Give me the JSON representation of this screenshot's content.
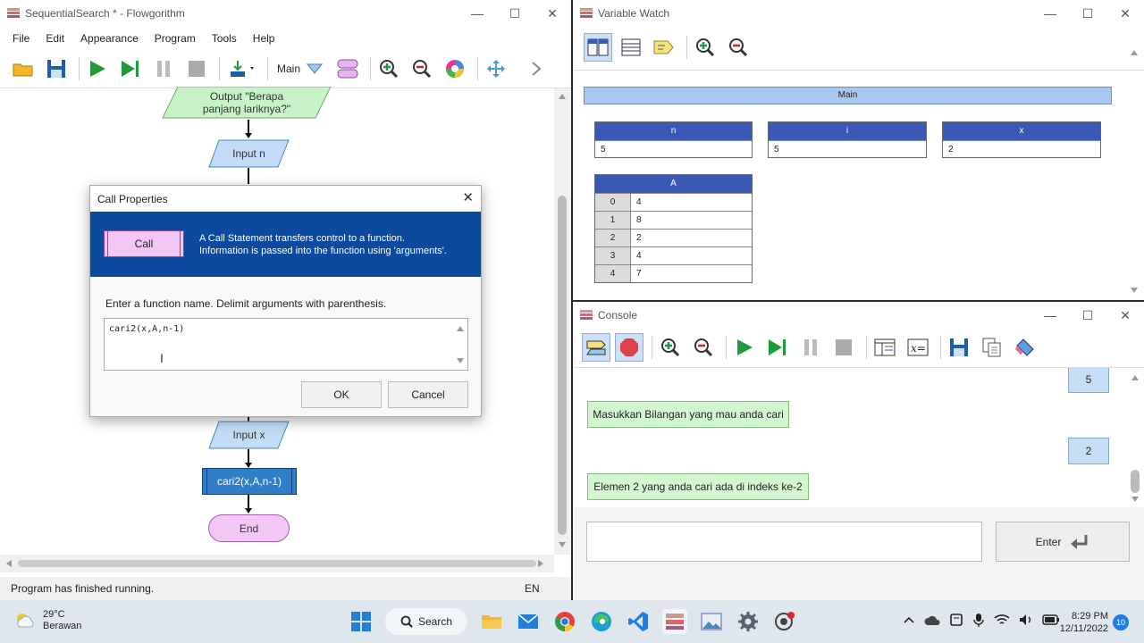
{
  "flowgorithm": {
    "title": "SequentialSearch * - Flowgorithm",
    "menu": [
      "File",
      "Edit",
      "Appearance",
      "Program",
      "Tools",
      "Help"
    ],
    "function_select": "Main",
    "shapes": {
      "output1": "Output \"Berapa panjang lariknya?\"",
      "input_n": "Input n",
      "input_x": "Input x",
      "call": "cari2(x,A,n-1)",
      "end": "End"
    },
    "status": "Program has finished running.",
    "lang": "EN"
  },
  "dialog": {
    "title": "Call Properties",
    "shape_label": "Call",
    "description_line1": "A Call Statement transfers control to a function.",
    "description_line2": "Information is passed into the function using 'arguments'.",
    "prompt": "Enter a function name. Delimit arguments with parenthesis.",
    "input_value": "cari2(x,A,n-1)",
    "ok_label": "OK",
    "cancel_label": "Cancel"
  },
  "watch": {
    "title": "Variable Watch",
    "scope": "Main",
    "vars": [
      {
        "name": "n",
        "value": "5"
      },
      {
        "name": "i",
        "value": "5"
      },
      {
        "name": "x",
        "value": "2"
      }
    ],
    "array_name": "A",
    "array": [
      {
        "idx": "0",
        "val": "4"
      },
      {
        "idx": "1",
        "val": "8"
      },
      {
        "idx": "2",
        "val": "2"
      },
      {
        "idx": "3",
        "val": "4"
      },
      {
        "idx": "4",
        "val": "7"
      }
    ]
  },
  "console": {
    "title": "Console",
    "user_input1": "5",
    "prompt_msg": "Masukkan Bilangan yang mau anda cari",
    "user_input2": "2",
    "result_msg": "Elemen 2 yang anda cari  ada di indeks ke-2",
    "input_value": "",
    "enter_label": "Enter"
  },
  "taskbar": {
    "temp": "29°C",
    "weather": "Berawan",
    "search_label": "Search",
    "time": "8:29 PM",
    "date": "12/11/2022",
    "notif_count": "10"
  },
  "colors": {
    "dialog_header": "#0b4a9e",
    "watch_header": "#3b58b5",
    "console_bubble_green": "#d3f5d0",
    "console_bubble_blue": "#c6def5",
    "call_shape": "#2f7ec7",
    "end_shape": "#f2c6f5"
  }
}
